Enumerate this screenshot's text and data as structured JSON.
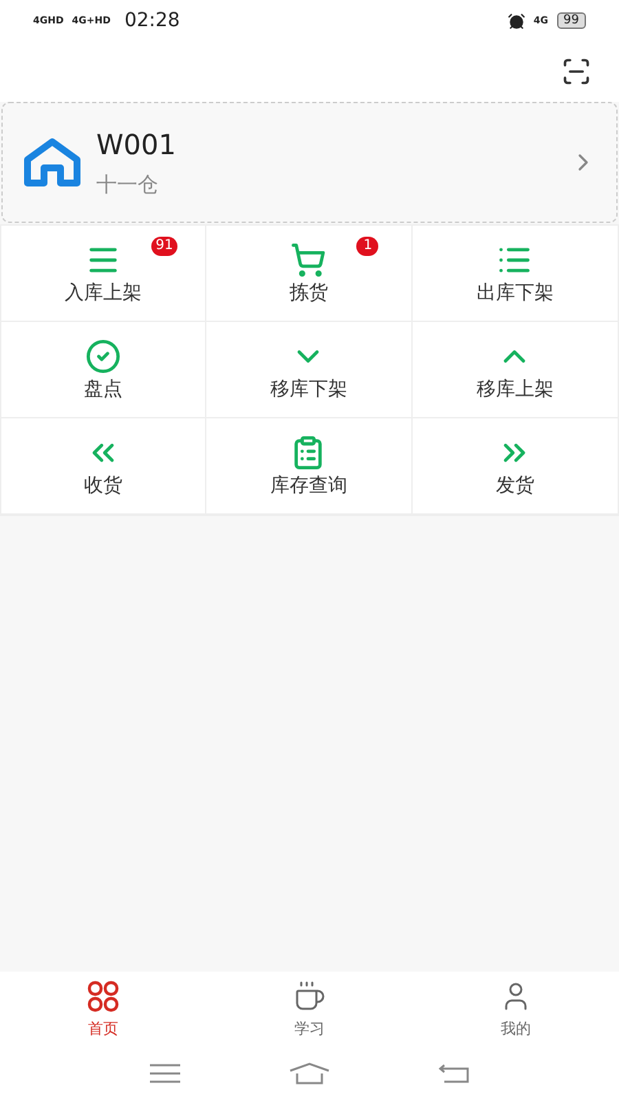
{
  "status_bar": {
    "networks": [
      "4GHD",
      "4G+HD"
    ],
    "time": "02:28",
    "mobile_data": "4G",
    "battery": "99"
  },
  "warehouse": {
    "code": "W001",
    "name": "十一仓"
  },
  "functions": [
    {
      "label": "入库上架",
      "badge": "91"
    },
    {
      "label": "拣货",
      "badge": "1"
    },
    {
      "label": "出库下架"
    },
    {
      "label": "盘点"
    },
    {
      "label": "移库下架"
    },
    {
      "label": "移库上架"
    },
    {
      "label": "收货"
    },
    {
      "label": "库存查询"
    },
    {
      "label": "发货"
    }
  ],
  "tab_bar": [
    {
      "label": "首页",
      "selected": true
    },
    {
      "label": "学习",
      "selected": false
    },
    {
      "label": "我的",
      "selected": false
    }
  ]
}
